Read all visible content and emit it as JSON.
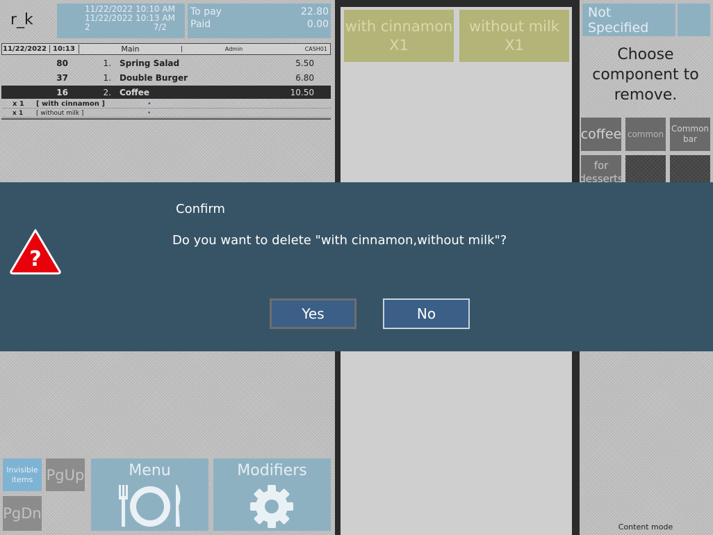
{
  "header": {
    "user": "r_k",
    "time_open": "11/22/2022 10:10 AM",
    "time_last": "11/22/2022 10:13 AM",
    "guests": "2",
    "table": "7/2",
    "to_pay_label": "To pay",
    "to_pay_value": "22.80",
    "paid_label": "Paid",
    "paid_value": "0.00"
  },
  "order_header": {
    "date": "11/22/2022",
    "time": "10:13",
    "section": "Main",
    "waiter": "Admin",
    "cash": "CASH01"
  },
  "order_lines": [
    {
      "code": "80",
      "qty": "1.",
      "name": "Spring Salad",
      "price": "5.50"
    },
    {
      "code": "37",
      "qty": "1.",
      "name": "Double Burger",
      "price": "6.80"
    },
    {
      "code": "16",
      "qty": "2.",
      "name": "Coffee",
      "price": "10.50"
    }
  ],
  "modifiers": [
    {
      "count": "x 1",
      "name": "[ with cinnamon ]"
    },
    {
      "count": "x 1",
      "name": "[ without milk ]"
    }
  ],
  "selected_modifiers": [
    {
      "label": "with cinnamon",
      "count": "X1"
    },
    {
      "label": "without milk",
      "count": "X1"
    }
  ],
  "right_panel": {
    "not_specified": "Not Specified",
    "instruction": "Choose component to remove.",
    "categories": [
      "coffee",
      "common",
      "Common bar",
      "for desserts"
    ],
    "content_mode": "Content mode"
  },
  "bottom": {
    "invisible_items": "Invisible items",
    "pgup": "PgUp",
    "pgdn": "PgDn",
    "menu": "Menu",
    "modifiers": "Modifiers"
  },
  "dialog": {
    "title": "Confirm",
    "message": "Do you want to delete \"with cinnamon,without milk\"?",
    "yes": "Yes",
    "no": "No",
    "icon": "question-warning-icon"
  },
  "colors": {
    "dialog_bg": "#375466",
    "button_bg": "#3b5f86",
    "warning_red": "#e8000b",
    "selected_row": "#2b2b2b"
  }
}
